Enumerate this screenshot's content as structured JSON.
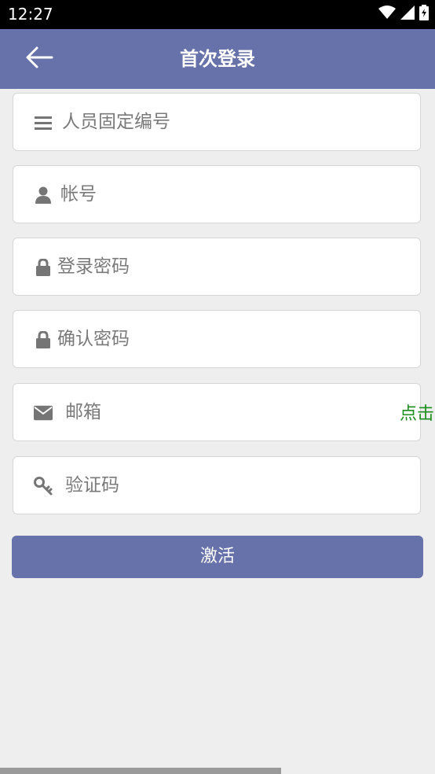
{
  "status_bar": {
    "time": "12:27",
    "icons": [
      "wifi-icon",
      "signal-icon",
      "battery-icon"
    ]
  },
  "header": {
    "title": "首次登录",
    "back_icon": "arrow-left-icon"
  },
  "form": {
    "fields": [
      {
        "name": "staff-id",
        "icon": "list-icon",
        "placeholder": "人员固定编号"
      },
      {
        "name": "account",
        "icon": "user-icon",
        "placeholder": "帐号"
      },
      {
        "name": "login-password",
        "icon": "lock-icon",
        "placeholder": "登录密码"
      },
      {
        "name": "confirm-password",
        "icon": "lock-icon",
        "placeholder": "确认密码"
      },
      {
        "name": "email",
        "icon": "envelope-icon",
        "placeholder": "邮箱"
      },
      {
        "name": "verification-code",
        "icon": "key-icon",
        "placeholder": "验证码"
      }
    ],
    "email_action_label": "点击",
    "submit_label": "激活"
  },
  "colors": {
    "header_bg": "#6772aa",
    "button_bg": "#6772aa",
    "link_green": "#1e8f1e",
    "page_bg": "#eeeeee"
  }
}
